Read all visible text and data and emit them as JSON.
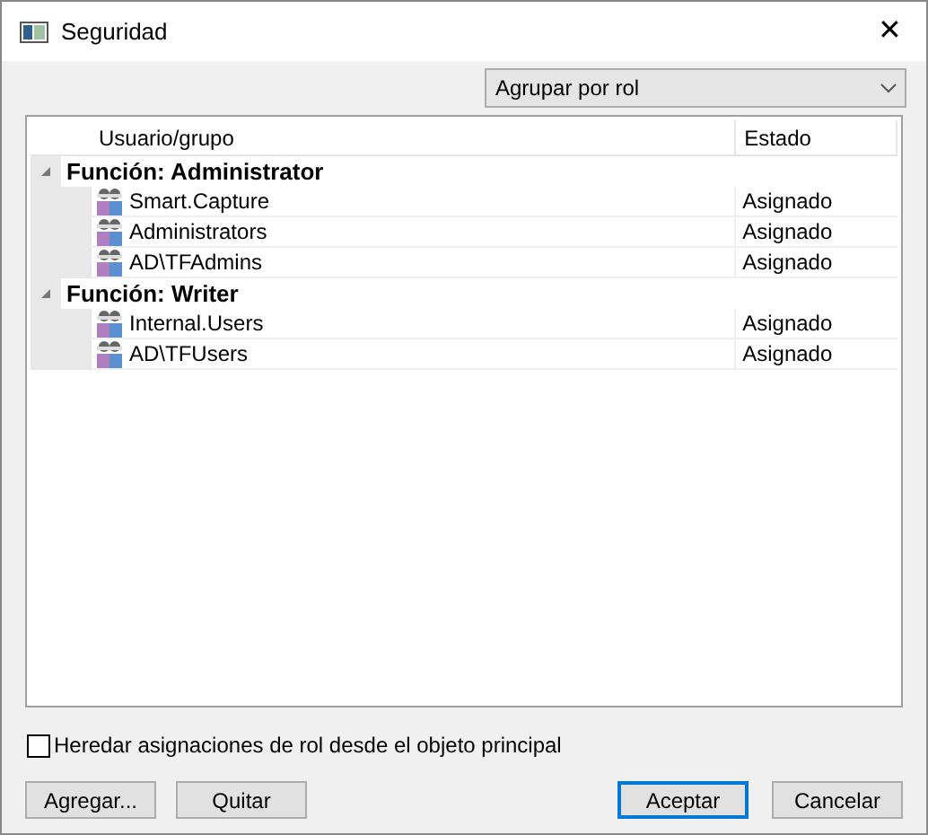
{
  "window": {
    "title": "Seguridad",
    "close": "✕"
  },
  "group_by": {
    "value": "Agrupar por rol"
  },
  "table": {
    "columns": [
      "Usuario/grupo",
      "Estado"
    ],
    "groups": [
      {
        "label": "Función: Administrator",
        "expanded": true,
        "rows": [
          {
            "name": "Smart.Capture",
            "status": "Asignado"
          },
          {
            "name": "Administrators",
            "status": "Asignado"
          },
          {
            "name": "AD\\TFAdmins",
            "status": "Asignado"
          }
        ]
      },
      {
        "label": "Función: Writer",
        "expanded": true,
        "rows": [
          {
            "name": "Internal.Users",
            "status": "Asignado"
          },
          {
            "name": "AD\\TFUsers",
            "status": "Asignado"
          }
        ]
      }
    ]
  },
  "inherit": {
    "label": "Heredar asignaciones de rol desde el objeto principal",
    "checked": false
  },
  "buttons": [
    {
      "label": "Agregar...",
      "default": false
    },
    {
      "label": "Quitar",
      "default": false
    },
    {
      "label": "Aceptar",
      "default": true
    },
    {
      "label": "Cancelar",
      "default": false
    }
  ]
}
